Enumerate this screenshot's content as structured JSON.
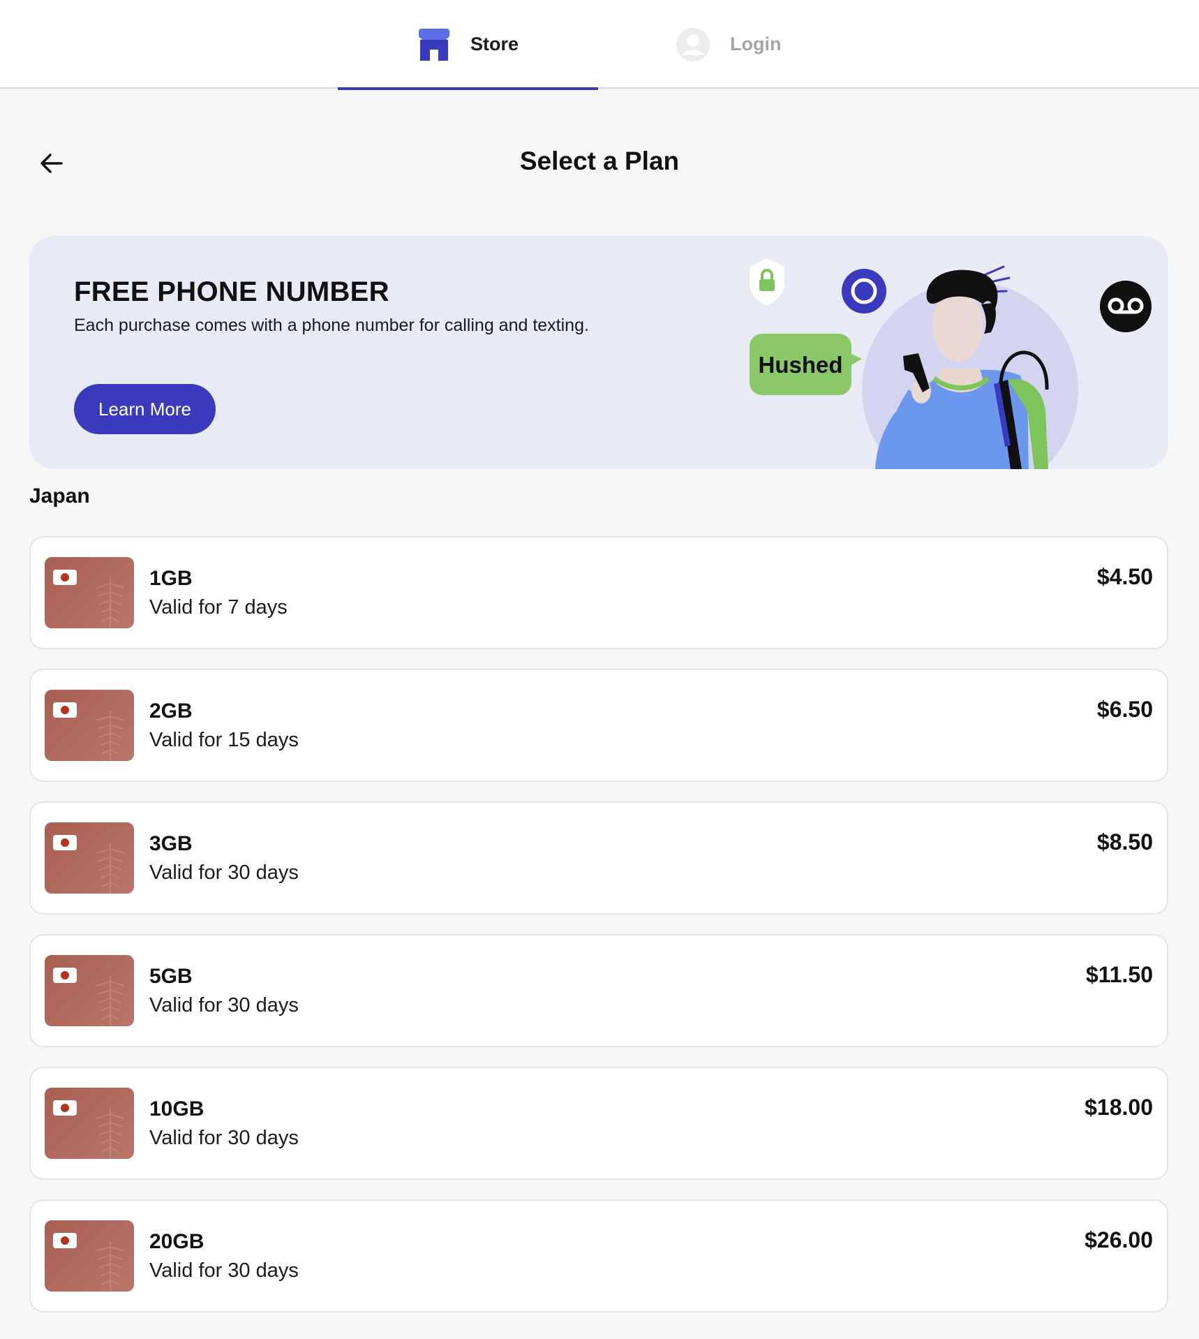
{
  "nav": {
    "tabs": [
      {
        "label": "Store",
        "icon": "store-icon",
        "active": true
      },
      {
        "label": "Login",
        "icon": "user-icon",
        "active": false
      }
    ]
  },
  "header": {
    "back_icon": "arrow-left-icon",
    "title": "Select a Plan"
  },
  "banner": {
    "title": "FREE PHONE NUMBER",
    "text": "Each purchase comes with a phone number for calling and texting.",
    "button_label": "Learn More",
    "bubble_text": "Hushed"
  },
  "section": {
    "title": "Japan"
  },
  "plans": [
    {
      "data": "1GB",
      "validity": "Valid for 7 days",
      "price": "$4.50"
    },
    {
      "data": "2GB",
      "validity": "Valid for 15 days",
      "price": "$6.50"
    },
    {
      "data": "3GB",
      "validity": "Valid for 30 days",
      "price": "$8.50"
    },
    {
      "data": "5GB",
      "validity": "Valid for 30 days",
      "price": "$11.50"
    },
    {
      "data": "10GB",
      "validity": "Valid for 30 days",
      "price": "$18.00"
    },
    {
      "data": "20GB",
      "validity": "Valid for 30 days",
      "price": "$26.00"
    }
  ],
  "colors": {
    "accent": "#3a3abf",
    "banner_bg": "#e8eaf6",
    "bubble_green": "#8ac86a",
    "card_thumb": "#a85f52"
  }
}
